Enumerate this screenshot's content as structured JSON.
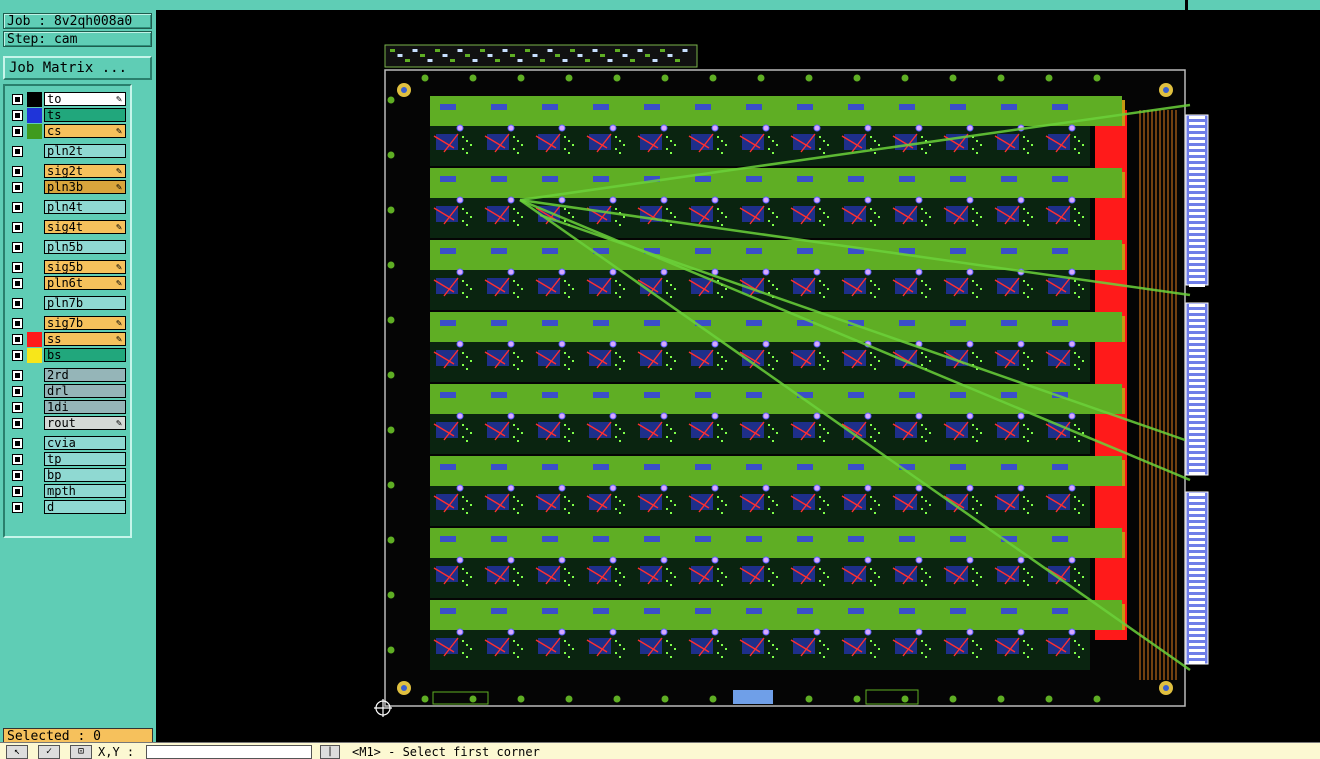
{
  "job_label": "Job : 8v2qh008a0",
  "step_label": "Step: cam",
  "job_matrix_button": "Job Matrix ...",
  "layers": [
    {
      "name": "to",
      "swatch": "#000000",
      "label_bg": "#ffffff",
      "edit": "true"
    },
    {
      "name": "ts",
      "swatch": "#1f34d9",
      "label_bg": "#21a77c",
      "edit": ""
    },
    {
      "name": "cs",
      "swatch": "#3f9b1e",
      "label_bg": "#f6c15c",
      "edit": "true"
    },
    {
      "name": "pln2t",
      "swatch": "",
      "label_bg": "#8fd9d2",
      "edit": ""
    },
    {
      "name": "sig2t",
      "swatch": "",
      "label_bg": "#f6c15c",
      "edit": "true"
    },
    {
      "name": "pln3b",
      "swatch": "",
      "label_bg": "#d9a53c",
      "edit": "true"
    },
    {
      "name": "pln4t",
      "swatch": "",
      "label_bg": "#8fd9d2",
      "edit": ""
    },
    {
      "name": "sig4t",
      "swatch": "",
      "label_bg": "#f6c15c",
      "edit": "true"
    },
    {
      "name": "pln5b",
      "swatch": "",
      "label_bg": "#8fd9d2",
      "edit": ""
    },
    {
      "name": "sig5b",
      "swatch": "",
      "label_bg": "#f6c15c",
      "edit": "true"
    },
    {
      "name": "pln6t",
      "swatch": "",
      "label_bg": "#f6c15c",
      "edit": "true"
    },
    {
      "name": "pln7b",
      "swatch": "",
      "label_bg": "#8fd9d2",
      "edit": ""
    },
    {
      "name": "sig7b",
      "swatch": "",
      "label_bg": "#f6c15c",
      "edit": "true"
    },
    {
      "name": "ss",
      "swatch": "#ff1a1a",
      "label_bg": "#f6c15c",
      "edit": "true"
    },
    {
      "name": "bs",
      "swatch": "#f7e61a",
      "label_bg": "#21a77c",
      "edit": ""
    },
    {
      "name": "2rd",
      "swatch": "",
      "label_bg": "#95b5b8",
      "edit": ""
    },
    {
      "name": "drl",
      "swatch": "",
      "label_bg": "#95b5b8",
      "edit": ""
    },
    {
      "name": "1di",
      "swatch": "",
      "label_bg": "#95b5b8",
      "edit": ""
    },
    {
      "name": "rout",
      "swatch": "",
      "label_bg": "#d4d9d6",
      "edit": "true"
    },
    {
      "name": "cvia",
      "swatch": "",
      "label_bg": "#8fd9d2",
      "edit": ""
    },
    {
      "name": "tp",
      "swatch": "",
      "label_bg": "#8fd9d2",
      "edit": ""
    },
    {
      "name": "bp",
      "swatch": "",
      "label_bg": "#8fd9d2",
      "edit": ""
    },
    {
      "name": "mpth",
      "swatch": "",
      "label_bg": "#8fd9d2",
      "edit": ""
    },
    {
      "name": "d",
      "swatch": "",
      "label_bg": "#8fd9d2",
      "edit": ""
    }
  ],
  "selected_label": "Selected : 0",
  "bottom": {
    "xy_label": "X,Y :",
    "xy_value": "",
    "prompt": "<M1> - Select first corner"
  },
  "colors": {
    "ui_teal": "#5fcdb5",
    "board_green": "#5fae24",
    "copper_red": "#ff1a1a",
    "gold": "#c49a12"
  },
  "icons": [
    "select-arrow-icon",
    "check-icon",
    "snap-icon",
    "center-crosshair-icon"
  ]
}
